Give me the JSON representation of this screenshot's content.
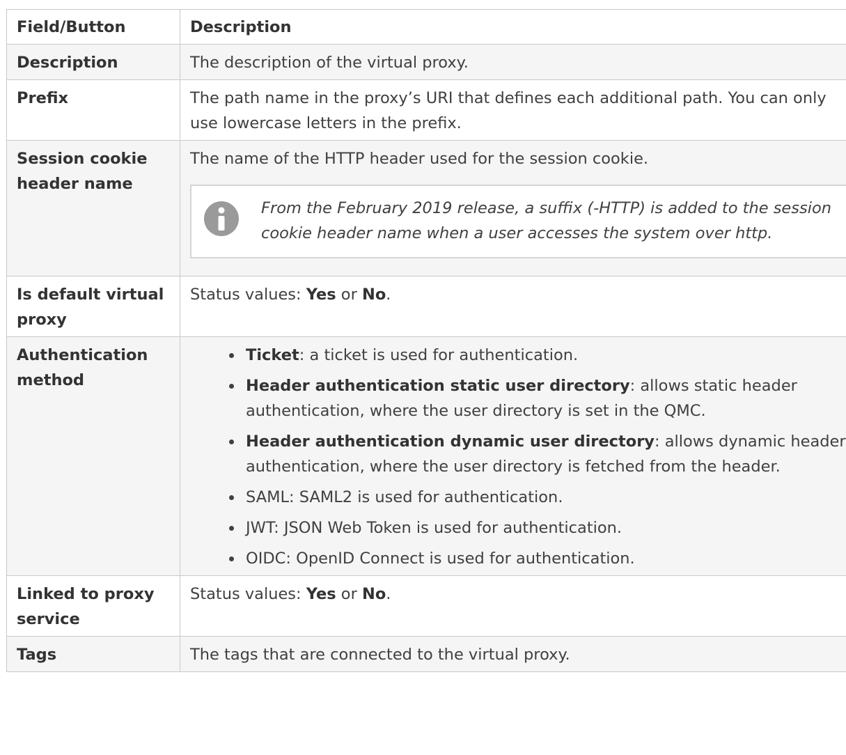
{
  "table": {
    "headers": [
      "Field/Button",
      "Description"
    ],
    "rows": {
      "description": {
        "field": "Description",
        "text": "The description of the virtual proxy."
      },
      "prefix": {
        "field": "Prefix",
        "text": "The path name in the proxy’s URI that defines each additional path. You can only use lowercase letters in the prefix."
      },
      "session_cookie": {
        "field": "Session cookie header name",
        "text": "The name of the HTTP header used for the session cookie.",
        "note": "From the February 2019 release, a suffix (-HTTP) is added to the session cookie header name when a user accesses the system over http.",
        "note_icon": "info-icon"
      },
      "is_default": {
        "field": "Is default virtual proxy",
        "prefix": "Status values: ",
        "yes": "Yes",
        "or": " or ",
        "no": "No",
        "end": "."
      },
      "auth_method": {
        "field": "Authentication method",
        "items": [
          {
            "term": "Ticket",
            "text": ": a ticket is used for authentication."
          },
          {
            "term": "Header authentication static user directory",
            "text": ": allows static header authentication, where the user directory is set in the QMC."
          },
          {
            "term": "Header authentication dynamic user directory",
            "text": ": allows dynamic header authentication, where the user directory is fetched from the header."
          },
          {
            "term": "",
            "text": "SAML: SAML2 is used for authentication."
          },
          {
            "term": "",
            "text": "JWT: JSON Web Token is used for authentication."
          },
          {
            "term": "",
            "text": "OIDC: OpenID Connect is used for authentication."
          }
        ]
      },
      "linked": {
        "field": "Linked to proxy service",
        "prefix": "Status values: ",
        "yes": "Yes",
        "or": " or ",
        "no": "No",
        "end": "."
      },
      "tags": {
        "field": "Tags",
        "text": "The tags that are connected to the virtual proxy."
      }
    }
  },
  "colors": {
    "border": "#c8c8c8",
    "shade": "#f5f5f5",
    "text": "#404040",
    "icon": "#9a9a9a"
  }
}
